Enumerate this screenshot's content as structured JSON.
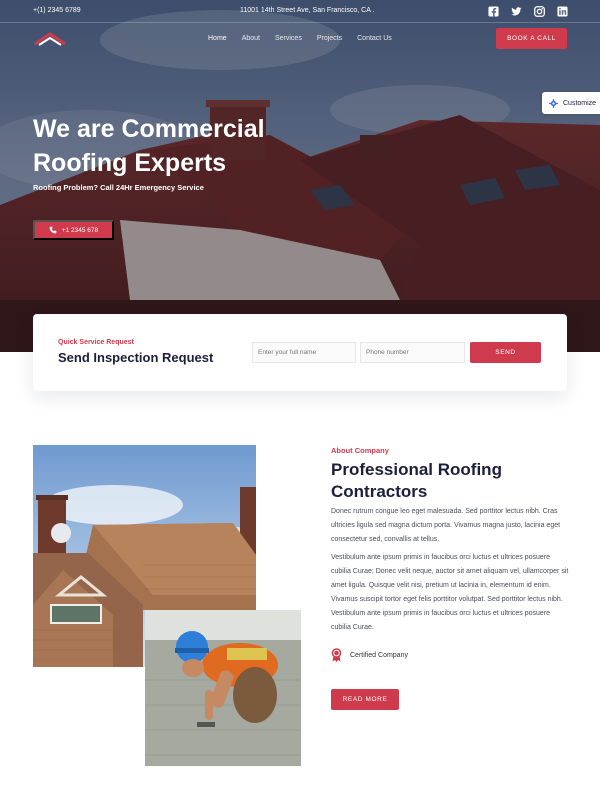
{
  "topbar": {
    "phone": "+(1) 2345 6789",
    "address": "11001 14th Street Ave, San Francisco, CA .",
    "socials": [
      "facebook-icon",
      "twitter-icon",
      "instagram-icon",
      "linkedin-icon"
    ]
  },
  "nav": {
    "items": [
      {
        "label": "Home",
        "active": true
      },
      {
        "label": "About",
        "active": false
      },
      {
        "label": "Services",
        "active": false
      },
      {
        "label": "Projects",
        "active": false
      },
      {
        "label": "Contact Us",
        "active": false
      }
    ],
    "book_label": "BOOK A CALL"
  },
  "customize_label": "Customize",
  "hero": {
    "title": "We are Commercial Roofing Experts",
    "subtitle": "Roofing Problem? Call 24Hr Emergency Service",
    "phone_button": "+1 2345 678"
  },
  "inspection": {
    "kicker": "Quick Service Request",
    "title": "Send Inspection Request",
    "name_placeholder": "Enter your full name",
    "phone_placeholder": "Phone number",
    "send_label": "SEND"
  },
  "about": {
    "kicker": "About Company",
    "title": "Professional Roofing Contractors",
    "paragraph1": "Donec rutrum congue leo eget malesuada. Sed porttitor lectus nibh. Cras ultricies ligula sed magna dictum porta. Vivamus magna justo, lacinia eget consectetur sed, convallis at tellus.",
    "paragraph2": "Vestibulum ante ipsum primis in faucibus orci luctus et ultrices posuere cubilia Curae; Donec velit neque, auctor sit amet aliquam vel, ullamcorper sit amet ligula. Quisque velit nisi, pretium ut lacinia in, elementum id enim. Vivamus suscipit tortor eget felis porttitor volutpat. Sed porttitor lectus nibh. Vestibulum ante ipsum primis in faucibus orci luctus et ultrices posuere cubilia Curae.",
    "certified": "Certified Company",
    "read_more": "READ MORE"
  },
  "colors": {
    "accent": "#cf3b4d",
    "heading": "#1b1f3a",
    "body_text": "#4a4d5c"
  }
}
